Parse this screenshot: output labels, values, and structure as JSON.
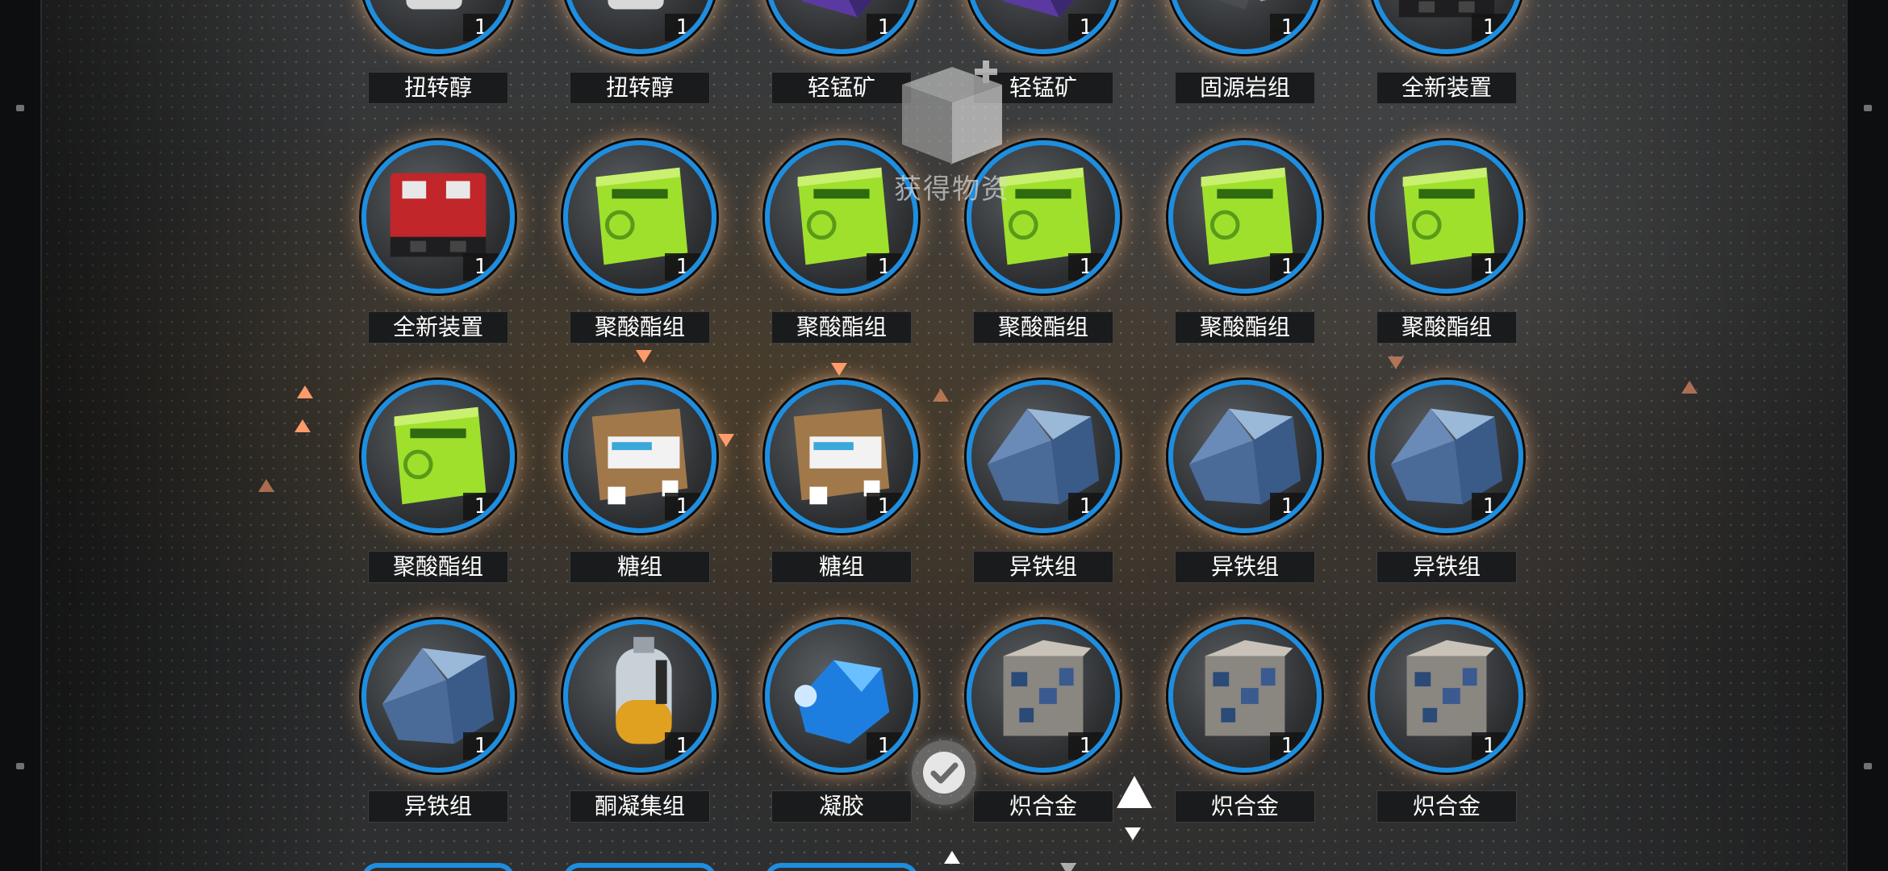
{
  "overlay": {
    "watermark_text": "获得物资",
    "confirm_icon": "check-icon"
  },
  "colors": {
    "ring": "#1e8ee0",
    "glow": "#ffc896",
    "label_bg": "#1a1b1c",
    "accent_triangle": "#ff9a6a"
  },
  "items": [
    {
      "label": "扭转醇",
      "count": "1",
      "icon": "torsion-alcohol"
    },
    {
      "label": "扭转醇",
      "count": "1",
      "icon": "torsion-alcohol"
    },
    {
      "label": "轻锰矿",
      "count": "1",
      "icon": "manganese-ore"
    },
    {
      "label": "轻锰矿",
      "count": "1",
      "icon": "manganese-ore"
    },
    {
      "label": "固源岩组",
      "count": "1",
      "icon": "orirock-cluster"
    },
    {
      "label": "全新装置",
      "count": "1",
      "icon": "new-device"
    },
    {
      "label": "全新装置",
      "count": "1",
      "icon": "new-device"
    },
    {
      "label": "聚酸酯组",
      "count": "1",
      "icon": "polyester-pack"
    },
    {
      "label": "聚酸酯组",
      "count": "1",
      "icon": "polyester-pack"
    },
    {
      "label": "聚酸酯组",
      "count": "1",
      "icon": "polyester-pack"
    },
    {
      "label": "聚酸酯组",
      "count": "1",
      "icon": "polyester-pack"
    },
    {
      "label": "聚酸酯组",
      "count": "1",
      "icon": "polyester-pack"
    },
    {
      "label": "聚酸酯组",
      "count": "1",
      "icon": "polyester-pack"
    },
    {
      "label": "糖组",
      "count": "1",
      "icon": "sugar-pack"
    },
    {
      "label": "糖组",
      "count": "1",
      "icon": "sugar-pack"
    },
    {
      "label": "异铁组",
      "count": "1",
      "icon": "oriron-cluster"
    },
    {
      "label": "异铁组",
      "count": "1",
      "icon": "oriron-cluster"
    },
    {
      "label": "异铁组",
      "count": "1",
      "icon": "oriron-cluster"
    },
    {
      "label": "异铁组",
      "count": "1",
      "icon": "oriron-cluster"
    },
    {
      "label": "酮凝集组",
      "count": "1",
      "icon": "aketon-bottle"
    },
    {
      "label": "凝胶",
      "count": "1",
      "icon": "gel"
    },
    {
      "label": "炽合金",
      "count": "1",
      "icon": "alloy-cube"
    },
    {
      "label": "炽合金",
      "count": "1",
      "icon": "alloy-cube"
    },
    {
      "label": "炽合金",
      "count": "1",
      "icon": "alloy-cube"
    }
  ]
}
